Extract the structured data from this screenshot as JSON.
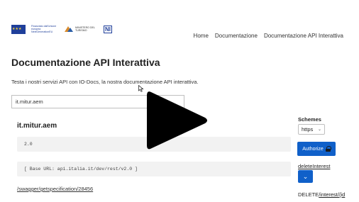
{
  "header": {
    "logos": {
      "eu_flag": "eu-flag-icon",
      "eu_text": "Finanziato dall'Unione europea NextGenerationEU",
      "ministry_text": "MINISTERO DEL TURISMO",
      "pnrr_mark": "NI"
    },
    "nav": [
      {
        "label": "Home"
      },
      {
        "label": "Documentazione"
      },
      {
        "label": "Documentazione API Interattiva"
      }
    ]
  },
  "main": {
    "title": "Documentazione API Interattiva",
    "intro": "Testa i nostri servizi API con IO-Docs, la nostra documentazione API interattiva.",
    "api_input_value": "it.mitur.aem",
    "api_name": "it.mitur.aem",
    "version": "2.0",
    "base_url": "[ Base URL: api.italia.it/dev/rest/v2.0 ]",
    "spec_link": "/swagger/getspecification/28456"
  },
  "side": {
    "schemes_label": "Schemes",
    "scheme_selected": "https",
    "authorize_label": "Authorize",
    "operation_name": "deleteInterest",
    "operation_method": "DELETE",
    "operation_path": "/interest/{id"
  },
  "overlay": {
    "icon": "play-icon"
  },
  "colors": {
    "accent_blue": "#1060c9",
    "code_bg": "#f2f2f2"
  }
}
